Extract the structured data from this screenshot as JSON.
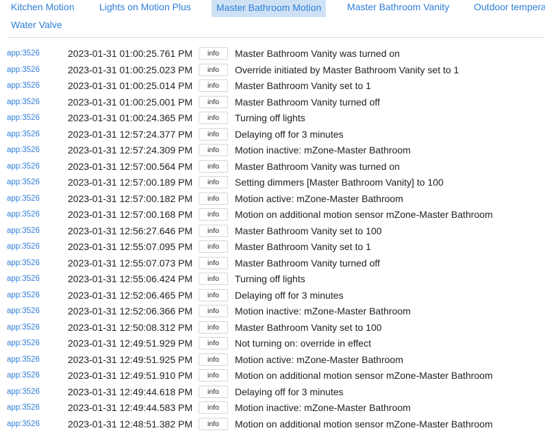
{
  "tabs": [
    {
      "label": "Kitchen Motion",
      "active": false
    },
    {
      "label": "Lights on Motion Plus",
      "active": false
    },
    {
      "label": "Master Bathroom Motion",
      "active": true
    },
    {
      "label": "Master Bathroom Vanity",
      "active": false
    },
    {
      "label": "Outdoor tempera",
      "active": false
    },
    {
      "label": "Water Valve",
      "active": false
    }
  ],
  "logs": [
    {
      "app": "app:3526",
      "time": "2023-01-31 01:00:25.761 PM",
      "level": "info",
      "message": "Master Bathroom Vanity was turned on"
    },
    {
      "app": "app:3526",
      "time": "2023-01-31 01:00:25.023 PM",
      "level": "info",
      "message": "Override initiated by Master Bathroom Vanity set to 1"
    },
    {
      "app": "app:3526",
      "time": "2023-01-31 01:00:25.014 PM",
      "level": "info",
      "message": "Master Bathroom Vanity set to 1"
    },
    {
      "app": "app:3526",
      "time": "2023-01-31 01:00:25.001 PM",
      "level": "info",
      "message": "Master Bathroom Vanity turned off"
    },
    {
      "app": "app:3526",
      "time": "2023-01-31 01:00:24.365 PM",
      "level": "info",
      "message": "Turning off lights"
    },
    {
      "app": "app:3526",
      "time": "2023-01-31 12:57:24.377 PM",
      "level": "info",
      "message": "Delaying off for 3 minutes"
    },
    {
      "app": "app:3526",
      "time": "2023-01-31 12:57:24.309 PM",
      "level": "info",
      "message": "Motion inactive: mZone-Master Bathroom"
    },
    {
      "app": "app:3526",
      "time": "2023-01-31 12:57:00.564 PM",
      "level": "info",
      "message": "Master Bathroom Vanity was turned on"
    },
    {
      "app": "app:3526",
      "time": "2023-01-31 12:57:00.189 PM",
      "level": "info",
      "message": "Setting dimmers [Master Bathroom Vanity] to 100"
    },
    {
      "app": "app:3526",
      "time": "2023-01-31 12:57:00.182 PM",
      "level": "info",
      "message": "Motion active: mZone-Master Bathroom"
    },
    {
      "app": "app:3526",
      "time": "2023-01-31 12:57:00.168 PM",
      "level": "info",
      "message": "Motion on additional motion sensor mZone-Master Bathroom"
    },
    {
      "app": "app:3526",
      "time": "2023-01-31 12:56:27.646 PM",
      "level": "info",
      "message": "Master Bathroom Vanity set to 100"
    },
    {
      "app": "app:3526",
      "time": "2023-01-31 12:55:07.095 PM",
      "level": "info",
      "message": "Master Bathroom Vanity set to 1"
    },
    {
      "app": "app:3526",
      "time": "2023-01-31 12:55:07.073 PM",
      "level": "info",
      "message": "Master Bathroom Vanity turned off"
    },
    {
      "app": "app:3526",
      "time": "2023-01-31 12:55:06.424 PM",
      "level": "info",
      "message": "Turning off lights"
    },
    {
      "app": "app:3526",
      "time": "2023-01-31 12:52:06.465 PM",
      "level": "info",
      "message": "Delaying off for 3 minutes"
    },
    {
      "app": "app:3526",
      "time": "2023-01-31 12:52:06.366 PM",
      "level": "info",
      "message": "Motion inactive: mZone-Master Bathroom"
    },
    {
      "app": "app:3526",
      "time": "2023-01-31 12:50:08.312 PM",
      "level": "info",
      "message": "Master Bathroom Vanity set to 100"
    },
    {
      "app": "app:3526",
      "time": "2023-01-31 12:49:51.929 PM",
      "level": "info",
      "message": "Not turning on: override in effect"
    },
    {
      "app": "app:3526",
      "time": "2023-01-31 12:49:51.925 PM",
      "level": "info",
      "message": "Motion active: mZone-Master Bathroom"
    },
    {
      "app": "app:3526",
      "time": "2023-01-31 12:49:51.910 PM",
      "level": "info",
      "message": "Motion on additional motion sensor mZone-Master Bathroom"
    },
    {
      "app": "app:3526",
      "time": "2023-01-31 12:49:44.618 PM",
      "level": "info",
      "message": "Delaying off for 3 minutes"
    },
    {
      "app": "app:3526",
      "time": "2023-01-31 12:49:44.583 PM",
      "level": "info",
      "message": "Motion inactive: mZone-Master Bathroom"
    },
    {
      "app": "app:3526",
      "time": "2023-01-31 12:48:51.382 PM",
      "level": "info",
      "message": "Motion on additional motion sensor mZone-Master Bathroom"
    }
  ],
  "colors": {
    "link": "#2e7ed8",
    "active_tab_bg": "#cfe2f5",
    "text": "#212121"
  }
}
